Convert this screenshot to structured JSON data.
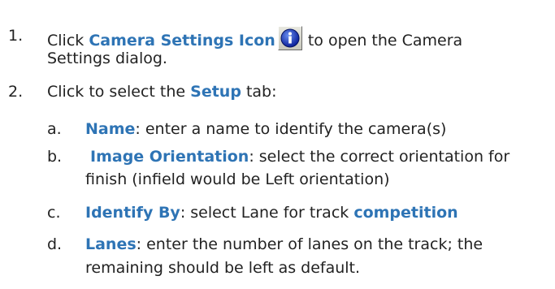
{
  "steps": [
    {
      "num": "1.",
      "prefix": "Click ",
      "bold": "Camera Settings Icon",
      "icon": "info-icon",
      "suffix": " to open the Camera",
      "cont": "Settings dialog."
    },
    {
      "num": "2.",
      "prefix": "Click to select the ",
      "bold": "Setup",
      "suffix": " tab:"
    }
  ],
  "substeps": [
    {
      "letter": "a.",
      "bold": "Name",
      "text": ": enter a name to identify the camera(s)"
    },
    {
      "letter": "b.",
      "bold": "Image Orientation",
      "text": ": select the correct orientation for",
      "cont": "finish (infield would be Left orientation)"
    },
    {
      "letter": "c.",
      "bold": "Identify By",
      "text": ": select Lane for track ",
      "bold2": "competition"
    },
    {
      "letter": "d.",
      "bold": "Lanes",
      "text": ": enter the number of lanes on the track; the",
      "cont": "remaining should be left as default."
    }
  ]
}
